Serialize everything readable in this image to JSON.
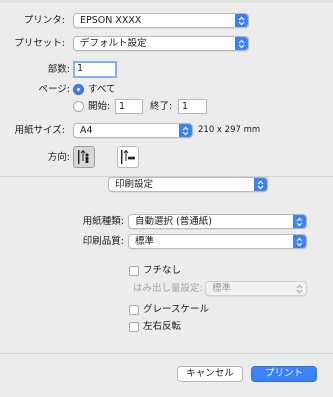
{
  "printer": {
    "label": "プリンタ:",
    "value": "EPSON XXXX"
  },
  "preset": {
    "label": "プリセット:",
    "value": "デフォルト設定"
  },
  "copies": {
    "label": "部数:",
    "value": "1"
  },
  "pages": {
    "label": "ページ:",
    "all_label": "すべて",
    "from_label": "開始:",
    "from_value": "1",
    "to_label": "終了:",
    "to_value": "1"
  },
  "paper_size": {
    "label": "用紙サイズ:",
    "value": "A4",
    "dimensions": "210 x 297 mm"
  },
  "orientation": {
    "label": "方向:",
    "selected": "portrait"
  },
  "section": {
    "value": "印刷設定"
  },
  "media_type": {
    "label": "用紙種類:",
    "value": "自動選択 (普通紙)"
  },
  "print_quality": {
    "label": "印刷品質:",
    "value": "標準"
  },
  "borderless": {
    "label": "フチなし",
    "checked": false
  },
  "expansion": {
    "label": "はみ出し量設定:",
    "value": "標準"
  },
  "grayscale": {
    "label": "グレースケール",
    "checked": false
  },
  "mirror": {
    "label": "左右反転",
    "checked": false
  },
  "buttons": {
    "cancel": "キャンセル",
    "print": "プリント"
  },
  "colors": {
    "accent": "#3b82f6",
    "background": "#ececec"
  },
  "icons": [
    "chevron-updown-icon",
    "portrait-orientation-icon",
    "landscape-orientation-icon"
  ]
}
